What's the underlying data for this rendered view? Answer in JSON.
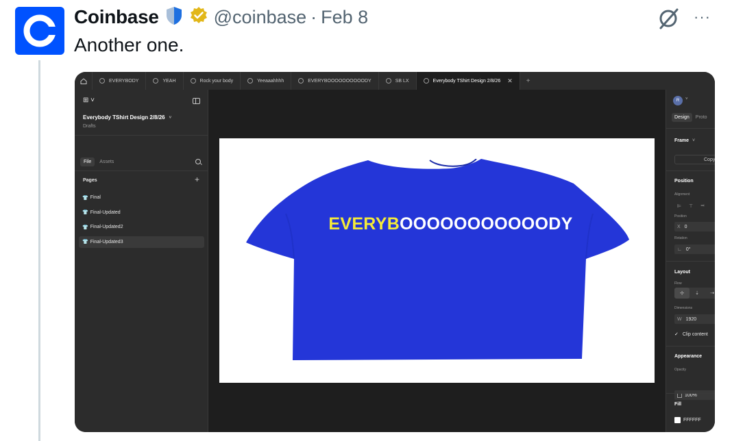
{
  "tweet": {
    "name": "Coinbase",
    "handle": "@coinbase",
    "separator": "·",
    "date": "Feb 8",
    "text": "Another one.",
    "more": "···",
    "brand_color": "#0052ff"
  },
  "app": {
    "tabs": [
      {
        "label": "EVERYBODY"
      },
      {
        "label": "YEAH"
      },
      {
        "label": "Rock your body"
      },
      {
        "label": "Yeeaaahhhh"
      },
      {
        "label": "EVERYBOOOOOOOOOODY"
      },
      {
        "label": "SB LX"
      },
      {
        "label": "Everybody TShirt Design 2/8/26",
        "active": true
      }
    ],
    "tab_close": "✕",
    "tab_add": "+",
    "left_panel": {
      "logo": "⊞ ˅",
      "file_name": "Everybody TShirt Design 2/8/26",
      "file_chevron": "˅",
      "project": "Drafts",
      "tab_file": "File",
      "tab_assets": "Assets",
      "pages_label": "Pages",
      "add_page": "+",
      "pages": [
        {
          "label": "Final"
        },
        {
          "label": "Final-Updated"
        },
        {
          "label": "Final-Updated2"
        },
        {
          "label": "Final-Updated3",
          "selected": true
        }
      ],
      "page_icon": "👕"
    },
    "canvas": {
      "shirt_color": "#2436d8",
      "shirt_text_highlight": "EVERYB",
      "shirt_text_rest": "OOOOOOOOOOODY",
      "highlight_color": "#f4ea3a"
    },
    "right_panel": {
      "avatar": "R",
      "avatar_chevron": "˅",
      "tab_design": "Design",
      "tab_prototype": "Proto",
      "frame_label": "Frame",
      "frame_chevron": "˅",
      "copy_button": "Copy t",
      "position_label": "Position",
      "alignment_label": "Alignment",
      "position_sub": "Position",
      "x_label": "X",
      "x_value": "0",
      "rotation_label": "Rotation",
      "rotation_icon": "∟",
      "rotation_value": "0°",
      "layout_label": "Layout",
      "flow_label": "Flow",
      "dimensions_label": "Dimensions",
      "w_label": "W",
      "w_value": "1920",
      "clip_label": "Clip content",
      "appearance_label": "Appearance",
      "opacity_label": "Opacity",
      "opacity_value": "100%",
      "fill_label": "Fill",
      "fill_value": "FFFFFF"
    }
  }
}
